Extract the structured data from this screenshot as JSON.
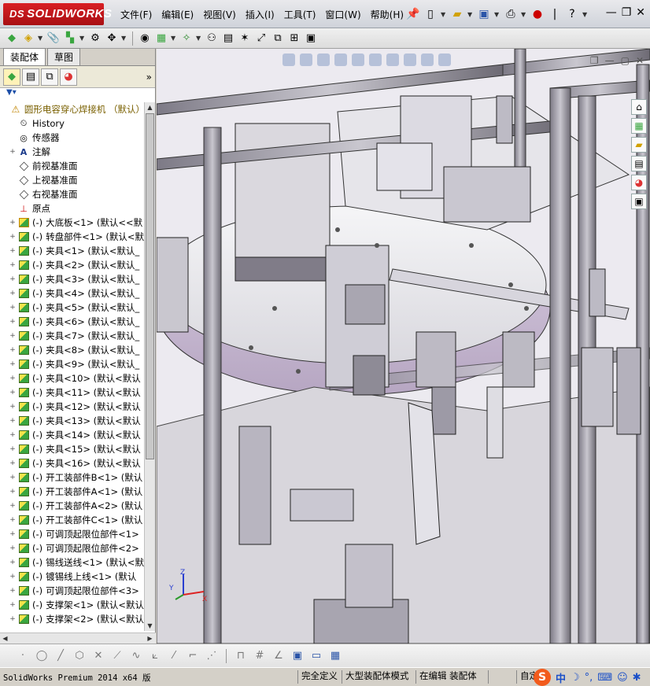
{
  "app": {
    "logo_brand": "SOLIDWORKS",
    "logo_mark": "DS"
  },
  "menu": [
    "文件(F)",
    "编辑(E)",
    "视图(V)",
    "插入(I)",
    "工具(T)",
    "窗口(W)",
    "帮助(H)"
  ],
  "panel": {
    "tabs": [
      "装配体",
      "草图"
    ],
    "more": "»",
    "tree": [
      {
        "exp": "",
        "icon": "warning-icon",
        "prefix": "",
        "label": "圆形电容穿心焊接机 （默认）",
        "root": true
      },
      {
        "exp": "",
        "icon": "history-icon",
        "prefix": "",
        "label": "History"
      },
      {
        "exp": "",
        "icon": "sensor-icon",
        "prefix": "",
        "label": "传感器"
      },
      {
        "exp": "+",
        "icon": "annotation-icon",
        "prefix": "",
        "label": "注解"
      },
      {
        "exp": "",
        "icon": "plane-icon",
        "prefix": "",
        "label": "前视基准面"
      },
      {
        "exp": "",
        "icon": "plane-icon",
        "prefix": "",
        "label": "上视基准面"
      },
      {
        "exp": "",
        "icon": "plane-icon",
        "prefix": "",
        "label": "右视基准面"
      },
      {
        "exp": "",
        "icon": "origin-icon",
        "prefix": "",
        "label": "原点"
      },
      {
        "exp": "+",
        "icon": "warning-cube-icon",
        "prefix": "(-)",
        "label": "大底板<1> (默认<<默"
      },
      {
        "exp": "+",
        "icon": "assembly-icon",
        "prefix": "(-)",
        "label": "转盘部件<1> (默认<默"
      },
      {
        "exp": "+",
        "icon": "assembly-icon",
        "prefix": "(-)",
        "label": "夹具<1> (默认<默认_"
      },
      {
        "exp": "+",
        "icon": "assembly-icon",
        "prefix": "(-)",
        "label": "夹具<2> (默认<默认_"
      },
      {
        "exp": "+",
        "icon": "assembly-icon",
        "prefix": "(-)",
        "label": "夹具<3> (默认<默认_"
      },
      {
        "exp": "+",
        "icon": "assembly-icon",
        "prefix": "(-)",
        "label": "夹具<4> (默认<默认_"
      },
      {
        "exp": "+",
        "icon": "assembly-icon",
        "prefix": "(-)",
        "label": "夹具<5> (默认<默认_"
      },
      {
        "exp": "+",
        "icon": "assembly-icon",
        "prefix": "(-)",
        "label": "夹具<6> (默认<默认_"
      },
      {
        "exp": "+",
        "icon": "assembly-icon",
        "prefix": "(-)",
        "label": "夹具<7> (默认<默认_"
      },
      {
        "exp": "+",
        "icon": "assembly-icon",
        "prefix": "(-)",
        "label": "夹具<8> (默认<默认_"
      },
      {
        "exp": "+",
        "icon": "assembly-icon",
        "prefix": "(-)",
        "label": "夹具<9> (默认<默认_"
      },
      {
        "exp": "+",
        "icon": "assembly-icon",
        "prefix": "(-)",
        "label": "夹具<10> (默认<默认"
      },
      {
        "exp": "+",
        "icon": "assembly-icon",
        "prefix": "(-)",
        "label": "夹具<11> (默认<默认"
      },
      {
        "exp": "+",
        "icon": "assembly-icon",
        "prefix": "(-)",
        "label": "夹具<12> (默认<默认"
      },
      {
        "exp": "+",
        "icon": "assembly-icon",
        "prefix": "(-)",
        "label": "夹具<13> (默认<默认"
      },
      {
        "exp": "+",
        "icon": "assembly-icon",
        "prefix": "(-)",
        "label": "夹具<14> (默认<默认"
      },
      {
        "exp": "+",
        "icon": "assembly-icon",
        "prefix": "(-)",
        "label": "夹具<15> (默认<默认"
      },
      {
        "exp": "+",
        "icon": "assembly-icon",
        "prefix": "(-)",
        "label": "夹具<16> (默认<默认"
      },
      {
        "exp": "+",
        "icon": "assembly-icon",
        "prefix": "(-)",
        "label": "开工装部件B<1> (默认"
      },
      {
        "exp": "+",
        "icon": "assembly-icon",
        "prefix": "(-)",
        "label": "开工装部件A<1> (默认"
      },
      {
        "exp": "+",
        "icon": "assembly-icon",
        "prefix": "(-)",
        "label": "开工装部件A<2> (默认"
      },
      {
        "exp": "+",
        "icon": "assembly-icon",
        "prefix": "(-)",
        "label": "开工装部件C<1> (默认"
      },
      {
        "exp": "+",
        "icon": "assembly-icon",
        "prefix": "(-)",
        "label": "可调顶起限位部件<1>"
      },
      {
        "exp": "+",
        "icon": "assembly-icon",
        "prefix": "(-)",
        "label": "可调顶起限位部件<2>"
      },
      {
        "exp": "+",
        "icon": "assembly-icon",
        "prefix": "(-)",
        "label": "锡线送线<1> (默认<默"
      },
      {
        "exp": "+",
        "icon": "assembly-icon",
        "prefix": "(-)",
        "label": "镀锡线上线<1> (默认"
      },
      {
        "exp": "+",
        "icon": "assembly-icon",
        "prefix": "(-)",
        "label": "可调顶起限位部件<3>"
      },
      {
        "exp": "+",
        "icon": "assembly-icon",
        "prefix": "(-)",
        "label": "支撑架<1> (默认<默认"
      },
      {
        "exp": "+",
        "icon": "assembly-icon",
        "prefix": "(-)",
        "label": "支撑架<2> (默认<默认"
      }
    ]
  },
  "triad": {
    "x": "X",
    "y": "Y",
    "z": "Z"
  },
  "status": {
    "product": "SolidWorks Premium 2014 x64 版",
    "defined": "完全定义",
    "mode": "大型装配体模式",
    "editing": "在编辑 装配体",
    "custom": "自定义"
  },
  "ime": {
    "logo": "S",
    "lang": "中"
  }
}
